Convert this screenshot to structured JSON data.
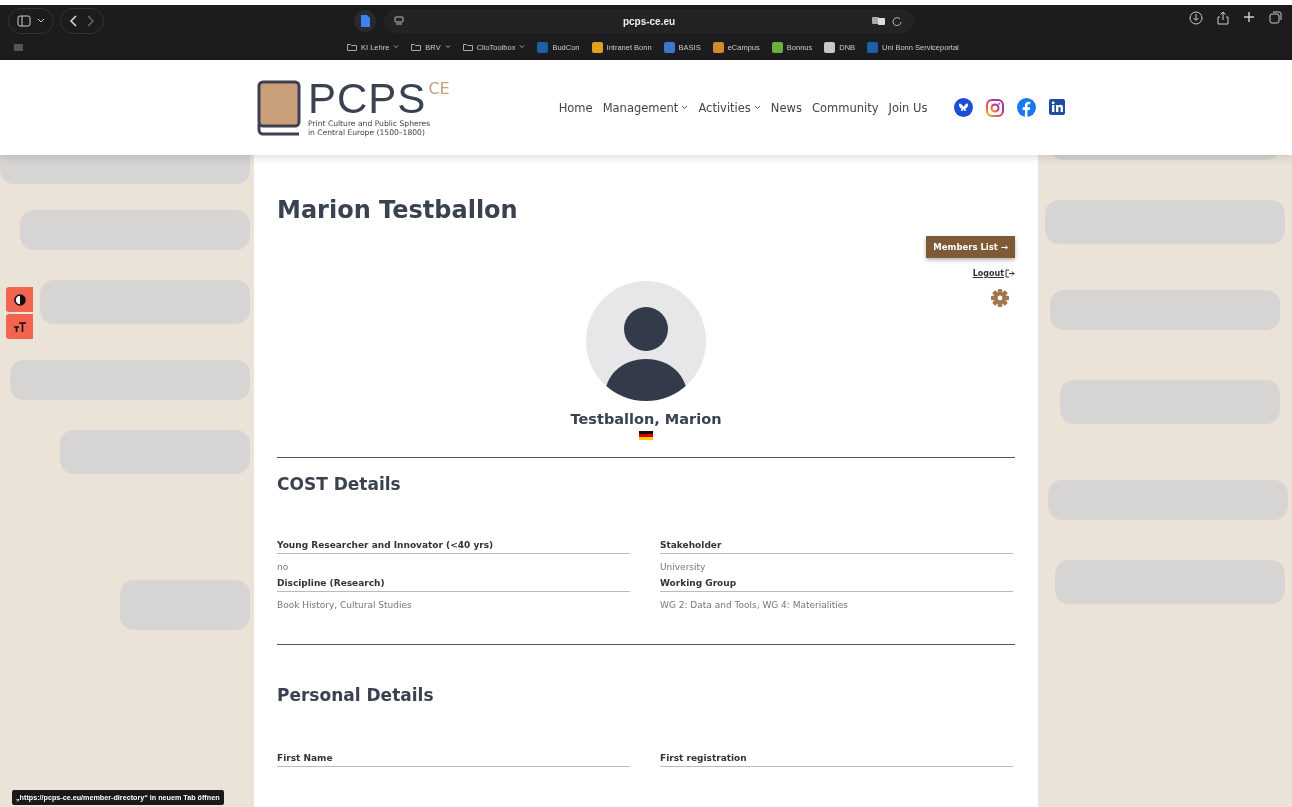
{
  "browser": {
    "address": "pcps-ce.eu",
    "bookmarks": [
      {
        "label": "KI Lehre",
        "kind": "folder"
      },
      {
        "label": "BRV",
        "kind": "folder"
      },
      {
        "label": "ClioToolbox",
        "kind": "folder"
      },
      {
        "label": "BudCon",
        "kind": "site",
        "color": "#1f5fa8"
      },
      {
        "label": "Intranet Bonn",
        "kind": "site",
        "color": "#e0a020"
      },
      {
        "label": "BASIS",
        "kind": "site",
        "color": "#3a78c8"
      },
      {
        "label": "eCampus",
        "kind": "site",
        "color": "#d08a30"
      },
      {
        "label": "Bonnus",
        "kind": "site",
        "color": "#6cb040"
      },
      {
        "label": "DNB",
        "kind": "site",
        "color": "#c8c8c8"
      },
      {
        "label": "Uni Bonn Serviceportal",
        "kind": "site",
        "color": "#1f5fa8"
      }
    ]
  },
  "header": {
    "logo": {
      "title": "PCPS",
      "superscript": "CE",
      "subtitle": [
        "Print Culture and Public Spheres",
        "in Central Europe (1500–1800)"
      ]
    },
    "nav": [
      {
        "label": "Home",
        "dropdown": false
      },
      {
        "label": "Management",
        "dropdown": true
      },
      {
        "label": "Activities",
        "dropdown": true
      },
      {
        "label": "News",
        "dropdown": false
      },
      {
        "label": "Community",
        "dropdown": false
      },
      {
        "label": "Join Us",
        "dropdown": false
      }
    ]
  },
  "profile": {
    "title": "Marion Testballon",
    "members_button": "Members List →",
    "logout": "Logout",
    "name": "Testballon, Marion",
    "sections": [
      {
        "title": "COST Details",
        "fields": [
          {
            "label": "Young Researcher and Innovator (<40 yrs)",
            "value": "no"
          },
          {
            "label": "Stakeholder",
            "value": "University"
          },
          {
            "label": "Discipline (Research)",
            "value": "Book History, Cultural Studies"
          },
          {
            "label": "Working Group",
            "value": "WG 2: Data and Tools, WG 4: Materialities"
          }
        ]
      },
      {
        "title": "Personal Details",
        "fields": [
          {
            "label": "First Name"
          },
          {
            "label": "First registration"
          }
        ]
      }
    ]
  },
  "status_hover": "„https://pcps-ce.eu/member-directory“ in neuem Tab öffnen"
}
